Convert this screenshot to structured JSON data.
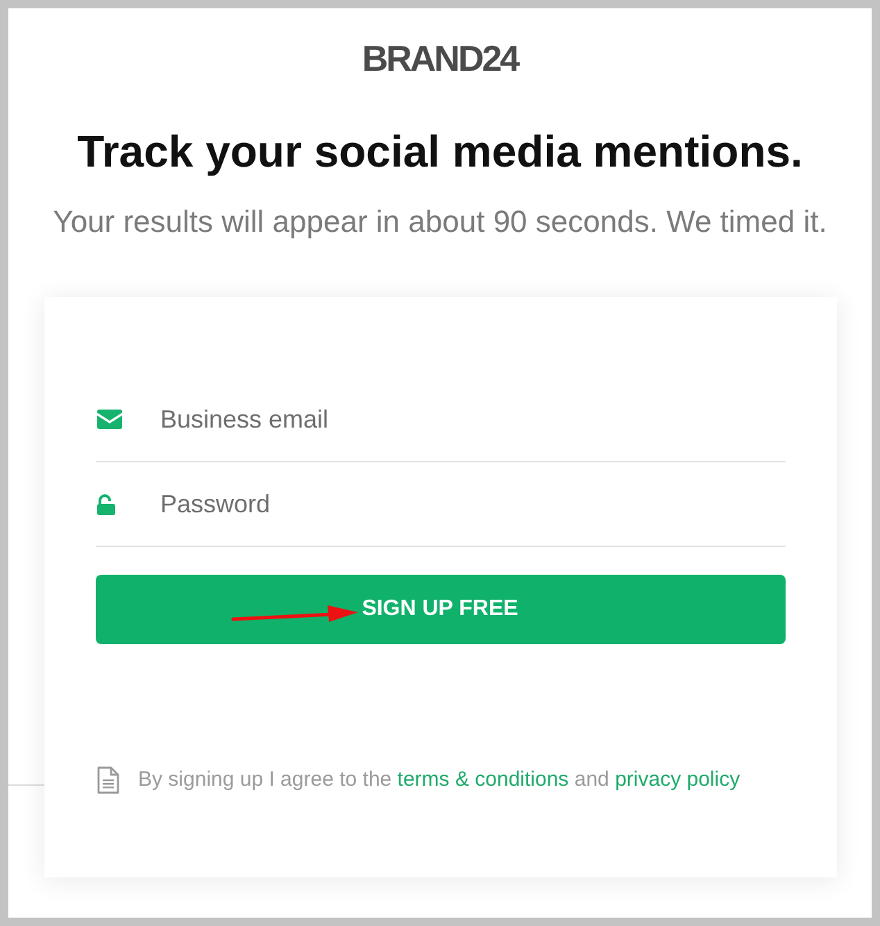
{
  "logo": {
    "text": "BRAND24"
  },
  "heading": "Track your social media mentions.",
  "subheading": "Your results will appear in about 90 seconds. We timed it.",
  "form": {
    "fields": [
      {
        "kind": "email",
        "placeholder": "Business email"
      },
      {
        "kind": "password",
        "placeholder": "Password"
      }
    ],
    "submit_button": {
      "label": "SIGN UP FREE"
    },
    "agreement": [
      {
        "kind": "text",
        "text": "By signing up I agree to the"
      },
      {
        "kind": "link",
        "text": "terms & conditions"
      },
      {
        "kind": "text",
        "text": "and"
      },
      {
        "kind": "link",
        "text": "privacy policy"
      }
    ]
  }
}
